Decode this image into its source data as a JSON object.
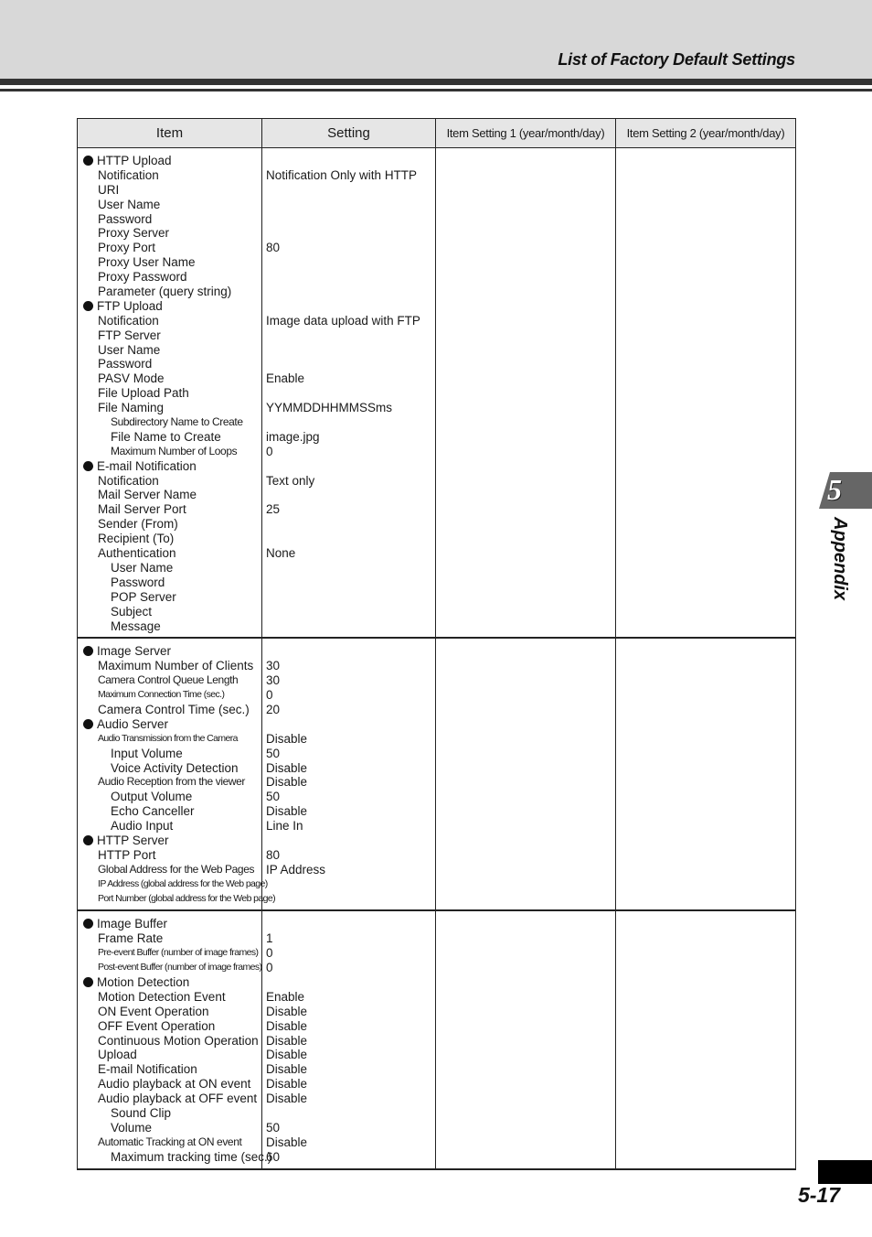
{
  "header": {
    "section_title": "List of Factory Default Settings"
  },
  "table": {
    "columns": [
      "Item",
      "Setting",
      "Item Setting 1 (year/month/day)",
      "Item Setting 2 (year/month/day)"
    ],
    "groups": [
      {
        "rows": [
          {
            "item": "HTTP Upload",
            "setting": "",
            "level": 0,
            "bullet": true
          },
          {
            "item": "Notification",
            "setting": "Notification Only with HTTP",
            "level": 1
          },
          {
            "item": "URI",
            "setting": "",
            "level": 1
          },
          {
            "item": "User Name",
            "setting": "",
            "level": 1
          },
          {
            "item": "Password",
            "setting": "",
            "level": 1
          },
          {
            "item": "Proxy Server",
            "setting": "",
            "level": 1
          },
          {
            "item": "Proxy Port",
            "setting": "80",
            "level": 1
          },
          {
            "item": "Proxy User Name",
            "setting": "",
            "level": 1
          },
          {
            "item": "Proxy Password",
            "setting": "",
            "level": 1
          },
          {
            "item": "Parameter (query string)",
            "setting": "",
            "level": 1
          },
          {
            "item": "FTP Upload",
            "setting": "",
            "level": 0,
            "bullet": true
          },
          {
            "item": "Notification",
            "setting": "Image data upload with FTP",
            "level": 1
          },
          {
            "item": "FTP Server",
            "setting": "",
            "level": 1
          },
          {
            "item": "User Name",
            "setting": "",
            "level": 1
          },
          {
            "item": "Password",
            "setting": "",
            "level": 1
          },
          {
            "item": "PASV Mode",
            "setting": "Enable",
            "level": 1
          },
          {
            "item": "File Upload Path",
            "setting": "",
            "level": 1
          },
          {
            "item": "File Naming",
            "setting": "YYMMDDHHMMSSms",
            "level": 1
          },
          {
            "item": "Subdirectory Name to Create",
            "setting": "",
            "level": 2,
            "size": "small"
          },
          {
            "item": "File Name to Create",
            "setting": "image.jpg",
            "level": 2
          },
          {
            "item": "Maximum Number of Loops",
            "setting": "0",
            "level": 2,
            "size": "small"
          },
          {
            "item": "E-mail Notification",
            "setting": "",
            "level": 0,
            "bullet": true
          },
          {
            "item": "Notification",
            "setting": "Text only",
            "level": 1
          },
          {
            "item": "Mail Server Name",
            "setting": "",
            "level": 1
          },
          {
            "item": "Mail Server Port",
            "setting": "25",
            "level": 1
          },
          {
            "item": "Sender (From)",
            "setting": "",
            "level": 1
          },
          {
            "item": "Recipient (To)",
            "setting": "",
            "level": 1
          },
          {
            "item": "Authentication",
            "setting": "None",
            "level": 1
          },
          {
            "item": "User Name",
            "setting": "",
            "level": 2
          },
          {
            "item": "Password",
            "setting": "",
            "level": 2
          },
          {
            "item": "POP Server",
            "setting": "",
            "level": 2
          },
          {
            "item": "Subject",
            "setting": "",
            "level": 2
          },
          {
            "item": "Message",
            "setting": "",
            "level": 2
          }
        ]
      },
      {
        "rows": [
          {
            "item": "Image Server",
            "setting": "",
            "level": 0,
            "bullet": true
          },
          {
            "item": "Maximum Number of Clients",
            "setting": "30",
            "level": 1
          },
          {
            "item": "Camera Control Queue Length",
            "setting": "30",
            "level": 1,
            "size": "small"
          },
          {
            "item": "Maximum Connection Time (sec.)",
            "setting": "0",
            "level": 1,
            "size": "xsmall"
          },
          {
            "item": "Camera Control Time (sec.)",
            "setting": "20",
            "level": 1
          },
          {
            "item": "Audio Server",
            "setting": "",
            "level": 0,
            "bullet": true
          },
          {
            "item": "Audio Transmission from the Camera",
            "setting": "Disable",
            "level": 1,
            "size": "xsmall"
          },
          {
            "item": "Input Volume",
            "setting": "50",
            "level": 2
          },
          {
            "item": "Voice Activity Detection",
            "setting": "Disable",
            "level": 2
          },
          {
            "item": "Audio Reception from the viewer",
            "setting": "Disable",
            "level": 1,
            "size": "small"
          },
          {
            "item": "Output Volume",
            "setting": "50",
            "level": 2
          },
          {
            "item": "Echo Canceller",
            "setting": "Disable",
            "level": 2
          },
          {
            "item": "Audio Input",
            "setting": "Line In",
            "level": 2
          },
          {
            "item": "HTTP Server",
            "setting": "",
            "level": 0,
            "bullet": true
          },
          {
            "item": "HTTP Port",
            "setting": "80",
            "level": 1
          },
          {
            "item": "Global Address for the Web Pages",
            "setting": "IP Address",
            "level": 1,
            "size": "small"
          },
          {
            "item": "IP Address (global address for the Web page)",
            "setting": "",
            "level": 1,
            "size": "xsmall"
          },
          {
            "item": "Port Number (global address for the Web page)",
            "setting": "",
            "level": 1,
            "size": "xsmall"
          }
        ]
      },
      {
        "rows": [
          {
            "item": "Image Buffer",
            "setting": "",
            "level": 0,
            "bullet": true
          },
          {
            "item": "Frame Rate",
            "setting": "1",
            "level": 1
          },
          {
            "item": "Pre-event Buffer (number of image frames)",
            "setting": "0",
            "level": 1,
            "size": "xsmall"
          },
          {
            "item": "Post-event Buffer (number of image frames)",
            "setting": "0",
            "level": 1,
            "size": "xsmall"
          },
          {
            "item": "Motion Detection",
            "setting": "",
            "level": 0,
            "bullet": true
          },
          {
            "item": "Motion Detection Event",
            "setting": "Enable",
            "level": 1
          },
          {
            "item": "ON Event Operation",
            "setting": "Disable",
            "level": 1
          },
          {
            "item": "OFF Event Operation",
            "setting": "Disable",
            "level": 1
          },
          {
            "item": "Continuous Motion Operation",
            "setting": "Disable",
            "level": 1
          },
          {
            "item": "Upload",
            "setting": "Disable",
            "level": 1
          },
          {
            "item": "E-mail Notification",
            "setting": "Disable",
            "level": 1
          },
          {
            "item": "Audio playback at ON event",
            "setting": "Disable",
            "level": 1
          },
          {
            "item": "Audio playback at OFF event",
            "setting": "Disable",
            "level": 1
          },
          {
            "item": "Sound Clip",
            "setting": "",
            "level": 2
          },
          {
            "item": "Volume",
            "setting": "50",
            "level": 2
          },
          {
            "item": "Automatic Tracking at ON event",
            "setting": "Disable",
            "level": 1,
            "size": "small"
          },
          {
            "item": "Maximum tracking time (sec.)",
            "setting": "60",
            "level": 2
          }
        ]
      }
    ]
  },
  "chapter": {
    "number": "5",
    "label": "Appendix"
  },
  "footer": {
    "page_number": "5-17"
  }
}
